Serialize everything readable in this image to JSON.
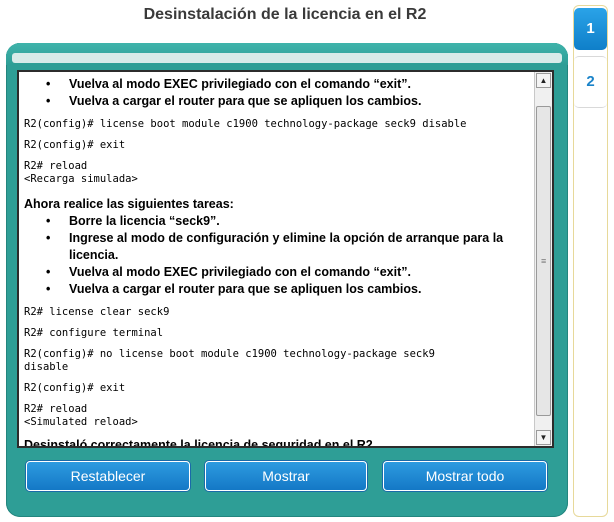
{
  "title": "Desinstalación de la licencia en el R2",
  "content": {
    "bullets_a": [
      "Vuelva al modo EXEC privilegiado con el comando “exit”.",
      "Vuelva a cargar el router para que se apliquen los cambios."
    ],
    "cmd_a": [
      "R2(config)# license boot module c1900 technology-package seck9 disable",
      "R2(config)# exit",
      "R2# reload",
      "<Recarga simulada>"
    ],
    "heading": "Ahora realice las siguientes tareas:",
    "bullets_b": [
      "Borre la licencia “seck9”.",
      "Ingrese al modo de configuración y elimine la opción de arranque para la licencia.",
      "Vuelva al modo EXEC privilegiado con el comando “exit”.",
      "Vuelva a cargar el router para que se apliquen los cambios."
    ],
    "cmd_b": [
      "R2# license clear seck9",
      "R2# configure terminal",
      "R2(config)# no license boot module c1900 technology-package seck9\ndisable",
      "R2(config)# exit",
      "R2# reload",
      "<Simulated reload>"
    ],
    "final": "Desinstaló correctamente la licencia de seguridad en el R2."
  },
  "buttons": {
    "reset": "Restablecer",
    "show": "Mostrar",
    "show_all": "Mostrar todo"
  },
  "tabs": [
    "1",
    "2"
  ]
}
